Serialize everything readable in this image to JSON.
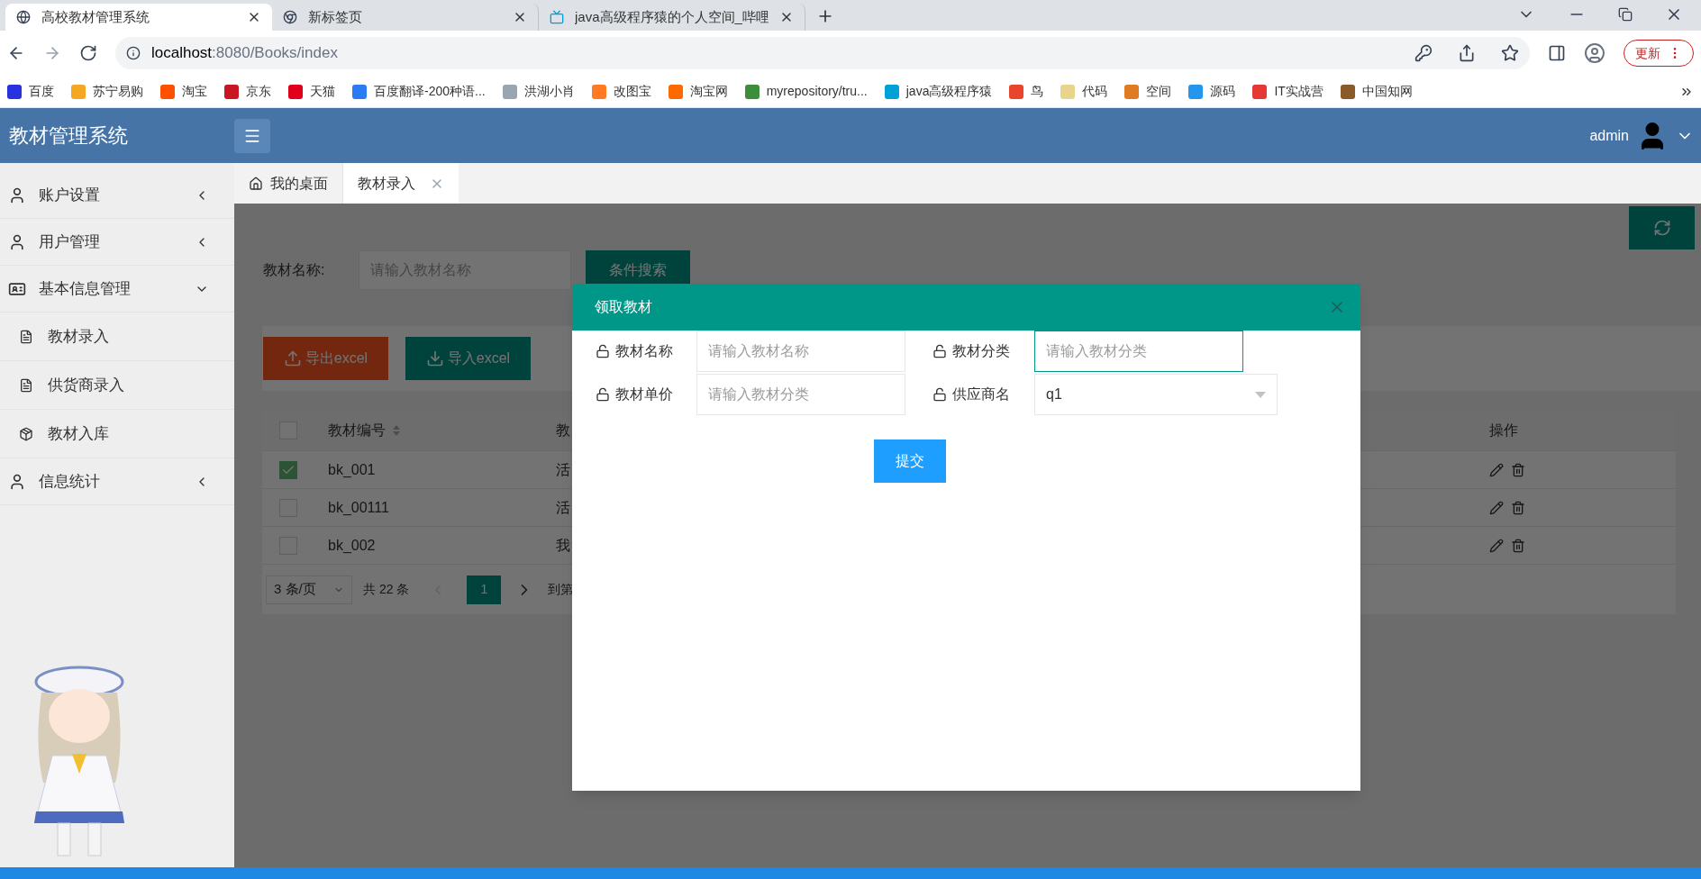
{
  "browser": {
    "tabs": [
      {
        "title": "高校教材管理系统",
        "selected": true,
        "kind": "globe"
      },
      {
        "title": "新标签页",
        "selected": false,
        "kind": "chrome"
      },
      {
        "title": "java高级程序猿的个人空间_哔哩",
        "selected": false,
        "kind": "tv"
      }
    ],
    "url_host": "localhost",
    "url_rest": ":8080/Books/index",
    "update_button": "更新",
    "bookmarks": [
      {
        "label": "百度",
        "color": "#2932e1"
      },
      {
        "label": "苏宁易购",
        "color": "#f5a623"
      },
      {
        "label": "淘宝",
        "color": "#ff5000"
      },
      {
        "label": "京东",
        "color": "#c91623"
      },
      {
        "label": "天猫",
        "color": "#e0001b"
      },
      {
        "label": "百度翻译-200种语...",
        "color": "#2b7bf2"
      },
      {
        "label": "洪湖小肖",
        "color": "#9aa5b1"
      },
      {
        "label": "改图宝",
        "color": "#ff7a21"
      },
      {
        "label": "淘宝网",
        "color": "#ff6a00"
      },
      {
        "label": "myrepository/tru...",
        "color": "#3c8d3c"
      },
      {
        "label": "java高级程序猿",
        "color": "#00a1d6"
      },
      {
        "label": "鸟",
        "color": "#e8452c"
      },
      {
        "label": "代码",
        "color": "#e8d48a"
      },
      {
        "label": "空间",
        "color": "#e07b24"
      },
      {
        "label": "源码",
        "color": "#2496ed"
      },
      {
        "label": "IT实战营",
        "color": "#e53935"
      },
      {
        "label": "中国知网",
        "color": "#8a5a2b"
      }
    ]
  },
  "app": {
    "title": "教材管理系统",
    "user": "admin"
  },
  "sidebar": [
    {
      "label": "账户设置",
      "expanded": false
    },
    {
      "label": "用户管理",
      "expanded": false
    },
    {
      "label": "基本信息管理",
      "expanded": true,
      "children": [
        {
          "label": "教材录入",
          "kind": "form"
        },
        {
          "label": "供货商录入",
          "kind": "form"
        },
        {
          "label": "教材入库",
          "kind": "stock"
        }
      ]
    },
    {
      "label": "信息统计",
      "expanded": false
    }
  ],
  "page_tabs": [
    {
      "label": "我的桌面",
      "selected": false,
      "kind": "home"
    },
    {
      "label": "教材录入",
      "selected": true,
      "kind": "page"
    }
  ],
  "search": {
    "label": "教材名称:",
    "placeholder": "请输入教材名称",
    "button": "条件搜索"
  },
  "toolbar": [
    {
      "label": "导出excel",
      "kind": "export"
    },
    {
      "label": "导入excel",
      "kind": "import"
    }
  ],
  "table": {
    "header_checked": false,
    "columns": [
      "教材编号",
      "教",
      "操作"
    ],
    "rows": [
      {
        "selected": true,
        "cells": [
          "bk_001",
          "活"
        ]
      },
      {
        "selected": false,
        "cells": [
          "bk_00111",
          "活"
        ]
      },
      {
        "selected": false,
        "cells": [
          "bk_002",
          "我"
        ]
      }
    ]
  },
  "pagination": {
    "page_size": "3 条/页",
    "total": "共 22 条",
    "pages": [
      {
        "label": "1",
        "selected": true
      }
    ],
    "goto": "到第"
  },
  "dialog": {
    "title": "领取教材",
    "submit": "提交",
    "fields": [
      {
        "label": "教材名称",
        "placeholder": "请输入教材名称",
        "kind": "input",
        "focused": false
      },
      {
        "label": "教材分类",
        "placeholder": "请输入教材分类",
        "kind": "input",
        "focused": true
      },
      {
        "label": "教材单价",
        "placeholder": "请输入教材分类",
        "kind": "input",
        "focused": false
      },
      {
        "label": "供应商名",
        "value": "q1",
        "kind": "select"
      }
    ]
  }
}
